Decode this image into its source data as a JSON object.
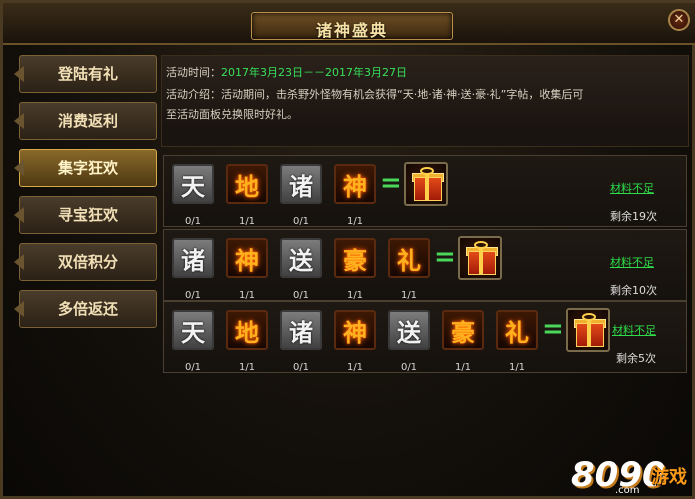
{
  "window": {
    "title": "诸神盛典",
    "close_symbol": "✕"
  },
  "sidebar": {
    "items": [
      {
        "label": "登陆有礼",
        "active": false
      },
      {
        "label": "消费返利",
        "active": false
      },
      {
        "label": "集字狂欢",
        "active": true
      },
      {
        "label": "寻宝狂欢",
        "active": false
      },
      {
        "label": "双倍积分",
        "active": false
      },
      {
        "label": "多倍返还",
        "active": false
      }
    ]
  },
  "info": {
    "time_label": "活动时间：",
    "time_value": "2017年3月23日－－2017年3月27日",
    "desc_line1": "活动介绍：活动期间，击杀野外怪物有机会获得“天·地·诸·神·送·豪·礼”字帖，收集后可",
    "desc_line2": "至活动面板兑换限时好礼。"
  },
  "rows": [
    {
      "tiles": [
        {
          "char": "天",
          "count": "0/1",
          "style": "gray"
        },
        {
          "char": "地",
          "count": "1/1",
          "style": "gold"
        },
        {
          "char": "诸",
          "count": "0/1",
          "style": "gray"
        },
        {
          "char": "神",
          "count": "1/1",
          "style": "gold"
        }
      ],
      "equals": "=",
      "status": "材料不足",
      "remaining": "剩余19次"
    },
    {
      "tiles": [
        {
          "char": "诸",
          "count": "0/1",
          "style": "gray"
        },
        {
          "char": "神",
          "count": "1/1",
          "style": "gold"
        },
        {
          "char": "送",
          "count": "0/1",
          "style": "gray"
        },
        {
          "char": "豪",
          "count": "1/1",
          "style": "gold"
        },
        {
          "char": "礼",
          "count": "1/1",
          "style": "gold"
        }
      ],
      "equals": "=",
      "status": "材料不足",
      "remaining": "剩余10次"
    },
    {
      "tiles": [
        {
          "char": "天",
          "count": "0/1",
          "style": "gray"
        },
        {
          "char": "地",
          "count": "1/1",
          "style": "gold"
        },
        {
          "char": "诸",
          "count": "0/1",
          "style": "gray"
        },
        {
          "char": "神",
          "count": "1/1",
          "style": "gold"
        },
        {
          "char": "送",
          "count": "0/1",
          "style": "gray"
        },
        {
          "char": "豪",
          "count": "1/1",
          "style": "gold"
        },
        {
          "char": "礼",
          "count": "1/1",
          "style": "gold"
        }
      ],
      "equals": "=",
      "status": "材料不足",
      "remaining": "剩余5次"
    }
  ],
  "watermark": {
    "number": "8090",
    "text": "游戏",
    "domain": ".com"
  }
}
